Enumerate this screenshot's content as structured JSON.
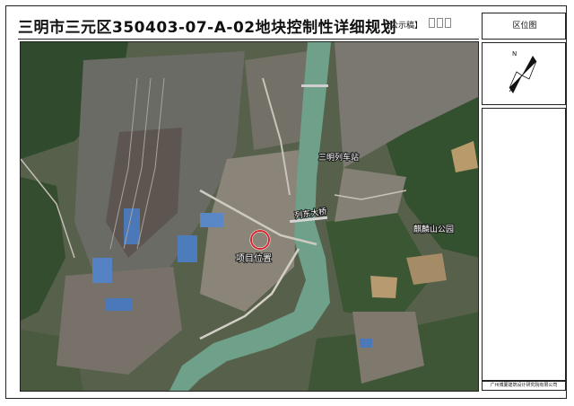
{
  "header": {
    "title": "三明市三元区350403-07-A-02地块控制性详细规划",
    "draft_label": "【公示稿】"
  },
  "side_panel": {
    "location_title": "区位图",
    "compass_letter": "N",
    "firm_name": "广州博厦建筑设计研究院有限公司"
  },
  "map_labels": {
    "station": "三明列车站",
    "bridge": "列东大桥",
    "park": "麒麟山公园",
    "project": "项目位置"
  },
  "colors": {
    "frame": "#222222",
    "marker_ring": "#d8232a",
    "river": "#6fa08a"
  }
}
